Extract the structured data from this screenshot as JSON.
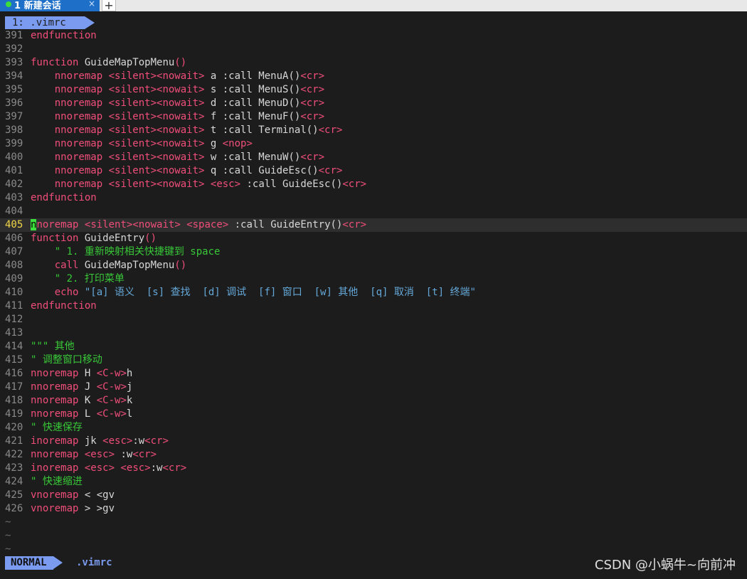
{
  "terminal_tab": {
    "title": "1 新建会话",
    "close": "×",
    "new_tab": "+"
  },
  "buffer_tab": {
    "label": "1: .vimrc"
  },
  "status": {
    "mode": "NORMAL",
    "file": ".vimrc"
  },
  "watermark": "CSDN @小蜗牛~向前冲",
  "cursor_line": "405",
  "lines": [
    {
      "n": "391",
      "segs": [
        [
          "k",
          "endfunction"
        ]
      ]
    },
    {
      "n": "392",
      "segs": []
    },
    {
      "n": "393",
      "segs": [
        [
          "k",
          "function"
        ],
        [
          "n",
          " GuideMapTopMenu"
        ],
        [
          "k",
          "()"
        ]
      ]
    },
    {
      "n": "394",
      "segs": [
        [
          "n",
          "    "
        ],
        [
          "k",
          "nnoremap"
        ],
        [
          "n",
          " "
        ],
        [
          "t",
          "<silent><nowait>"
        ],
        [
          "n",
          " a :call MenuA()"
        ],
        [
          "t",
          "<cr>"
        ]
      ]
    },
    {
      "n": "395",
      "segs": [
        [
          "n",
          "    "
        ],
        [
          "k",
          "nnoremap"
        ],
        [
          "n",
          " "
        ],
        [
          "t",
          "<silent><nowait>"
        ],
        [
          "n",
          " s :call MenuS()"
        ],
        [
          "t",
          "<cr>"
        ]
      ]
    },
    {
      "n": "396",
      "segs": [
        [
          "n",
          "    "
        ],
        [
          "k",
          "nnoremap"
        ],
        [
          "n",
          " "
        ],
        [
          "t",
          "<silent><nowait>"
        ],
        [
          "n",
          " d :call MenuD()"
        ],
        [
          "t",
          "<cr>"
        ]
      ]
    },
    {
      "n": "397",
      "segs": [
        [
          "n",
          "    "
        ],
        [
          "k",
          "nnoremap"
        ],
        [
          "n",
          " "
        ],
        [
          "t",
          "<silent><nowait>"
        ],
        [
          "n",
          " f :call MenuF()"
        ],
        [
          "t",
          "<cr>"
        ]
      ]
    },
    {
      "n": "398",
      "segs": [
        [
          "n",
          "    "
        ],
        [
          "k",
          "nnoremap"
        ],
        [
          "n",
          " "
        ],
        [
          "t",
          "<silent><nowait>"
        ],
        [
          "n",
          " t :call Terminal()"
        ],
        [
          "t",
          "<cr>"
        ]
      ]
    },
    {
      "n": "399",
      "segs": [
        [
          "n",
          "    "
        ],
        [
          "k",
          "nnoremap"
        ],
        [
          "n",
          " "
        ],
        [
          "t",
          "<silent><nowait>"
        ],
        [
          "n",
          " g "
        ],
        [
          "t",
          "<nop>"
        ]
      ]
    },
    {
      "n": "400",
      "segs": [
        [
          "n",
          "    "
        ],
        [
          "k",
          "nnoremap"
        ],
        [
          "n",
          " "
        ],
        [
          "t",
          "<silent><nowait>"
        ],
        [
          "n",
          " w :call MenuW()"
        ],
        [
          "t",
          "<cr>"
        ]
      ]
    },
    {
      "n": "401",
      "segs": [
        [
          "n",
          "    "
        ],
        [
          "k",
          "nnoremap"
        ],
        [
          "n",
          " "
        ],
        [
          "t",
          "<silent><nowait>"
        ],
        [
          "n",
          " q :call GuideEsc()"
        ],
        [
          "t",
          "<cr>"
        ]
      ]
    },
    {
      "n": "402",
      "segs": [
        [
          "n",
          "    "
        ],
        [
          "k",
          "nnoremap"
        ],
        [
          "n",
          " "
        ],
        [
          "t",
          "<silent><nowait>"
        ],
        [
          "n",
          " "
        ],
        [
          "t",
          "<esc>"
        ],
        [
          "n",
          " :call GuideEsc()"
        ],
        [
          "t",
          "<cr>"
        ]
      ]
    },
    {
      "n": "403",
      "segs": [
        [
          "k",
          "endfunction"
        ]
      ]
    },
    {
      "n": "404",
      "segs": []
    },
    {
      "n": "405",
      "segs": [
        [
          "cursor",
          "n"
        ],
        [
          "k",
          "noremap"
        ],
        [
          "n",
          " "
        ],
        [
          "t",
          "<silent><nowait>"
        ],
        [
          "n",
          " "
        ],
        [
          "t",
          "<space>"
        ],
        [
          "n",
          " :call GuideEntry()"
        ],
        [
          "t",
          "<cr>"
        ]
      ]
    },
    {
      "n": "406",
      "segs": [
        [
          "k",
          "function"
        ],
        [
          "n",
          " GuideEntry"
        ],
        [
          "k",
          "()"
        ]
      ]
    },
    {
      "n": "407",
      "segs": [
        [
          "n",
          "    "
        ],
        [
          "c",
          "\" 1. 重新映射相关快捷键到 space"
        ]
      ]
    },
    {
      "n": "408",
      "segs": [
        [
          "n",
          "    "
        ],
        [
          "k",
          "call"
        ],
        [
          "n",
          " GuideMapTopMenu"
        ],
        [
          "k",
          "()"
        ]
      ]
    },
    {
      "n": "409",
      "segs": [
        [
          "n",
          "    "
        ],
        [
          "c",
          "\" 2. 打印菜单"
        ]
      ]
    },
    {
      "n": "410",
      "segs": [
        [
          "n",
          "    "
        ],
        [
          "k",
          "echo"
        ],
        [
          "n",
          " "
        ],
        [
          "s",
          "\"[a] 语义  [s] 查找  [d] 调试  [f] 窗口  [w] 其他  [q] 取消  [t] 终端\""
        ]
      ]
    },
    {
      "n": "411",
      "segs": [
        [
          "k",
          "endfunction"
        ]
      ]
    },
    {
      "n": "412",
      "segs": []
    },
    {
      "n": "413",
      "segs": []
    },
    {
      "n": "414",
      "segs": [
        [
          "c",
          "\"\"\" 其他"
        ]
      ]
    },
    {
      "n": "415",
      "segs": [
        [
          "c",
          "\" 调整窗口移动"
        ]
      ]
    },
    {
      "n": "416",
      "segs": [
        [
          "k",
          "nnoremap"
        ],
        [
          "n",
          " H "
        ],
        [
          "t",
          "<C-w>"
        ],
        [
          "n",
          "h"
        ]
      ]
    },
    {
      "n": "417",
      "segs": [
        [
          "k",
          "nnoremap"
        ],
        [
          "n",
          " J "
        ],
        [
          "t",
          "<C-w>"
        ],
        [
          "n",
          "j"
        ]
      ]
    },
    {
      "n": "418",
      "segs": [
        [
          "k",
          "nnoremap"
        ],
        [
          "n",
          " K "
        ],
        [
          "t",
          "<C-w>"
        ],
        [
          "n",
          "k"
        ]
      ]
    },
    {
      "n": "419",
      "segs": [
        [
          "k",
          "nnoremap"
        ],
        [
          "n",
          " L "
        ],
        [
          "t",
          "<C-w>"
        ],
        [
          "n",
          "l"
        ]
      ]
    },
    {
      "n": "420",
      "segs": [
        [
          "c",
          "\" 快速保存"
        ]
      ]
    },
    {
      "n": "421",
      "segs": [
        [
          "k",
          "inoremap"
        ],
        [
          "n",
          " jk "
        ],
        [
          "t",
          "<esc>"
        ],
        [
          "n",
          ":w"
        ],
        [
          "t",
          "<cr>"
        ]
      ]
    },
    {
      "n": "422",
      "segs": [
        [
          "k",
          "nnoremap"
        ],
        [
          "n",
          " "
        ],
        [
          "t",
          "<esc>"
        ],
        [
          "n",
          " :w"
        ],
        [
          "t",
          "<cr>"
        ]
      ]
    },
    {
      "n": "423",
      "segs": [
        [
          "k",
          "inoremap"
        ],
        [
          "n",
          " "
        ],
        [
          "t",
          "<esc>"
        ],
        [
          "n",
          " "
        ],
        [
          "t",
          "<esc>"
        ],
        [
          "n",
          ":w"
        ],
        [
          "t",
          "<cr>"
        ]
      ]
    },
    {
      "n": "424",
      "segs": [
        [
          "c",
          "\" 快速缩进"
        ]
      ]
    },
    {
      "n": "425",
      "segs": [
        [
          "k",
          "vnoremap"
        ],
        [
          "n",
          " < <gv"
        ]
      ]
    },
    {
      "n": "426",
      "segs": [
        [
          "k",
          "vnoremap"
        ],
        [
          "n",
          " > >gv"
        ]
      ]
    }
  ],
  "tildes": [
    "~",
    "~",
    "~"
  ]
}
